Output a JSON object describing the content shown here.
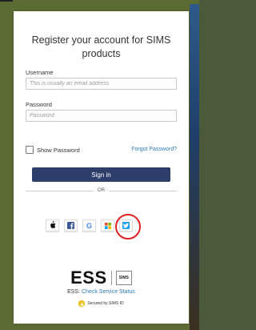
{
  "card": {
    "title": "Register your account for SIMS products",
    "username": {
      "label": "Username",
      "placeholder": "This is usually an email address"
    },
    "password": {
      "label": "Password",
      "placeholder": "Password"
    },
    "show_password_label": "Show Password",
    "forgot_password": "Forgot Password?",
    "signin_label": "Sign in",
    "or_text": "OR",
    "social_buttons": [
      {
        "icon": "apple-icon",
        "glyph": ""
      },
      {
        "icon": "facebook-icon",
        "glyph": "f"
      },
      {
        "icon": "google-icon",
        "glyph": "G"
      },
      {
        "icon": "microsoft-icon"
      },
      {
        "icon": "twitter-icon"
      }
    ],
    "footer": {
      "ess_logo": "ESS",
      "sims_logo": "SIMS",
      "status_prefix": "ESS: ",
      "status_link": "Check Service Status",
      "secured_text": "Secured by SIMS ID"
    }
  },
  "colors": {
    "primary_button": "#2d3e6b",
    "link": "#2b7bb9",
    "highlight_circle": "#e02020"
  }
}
